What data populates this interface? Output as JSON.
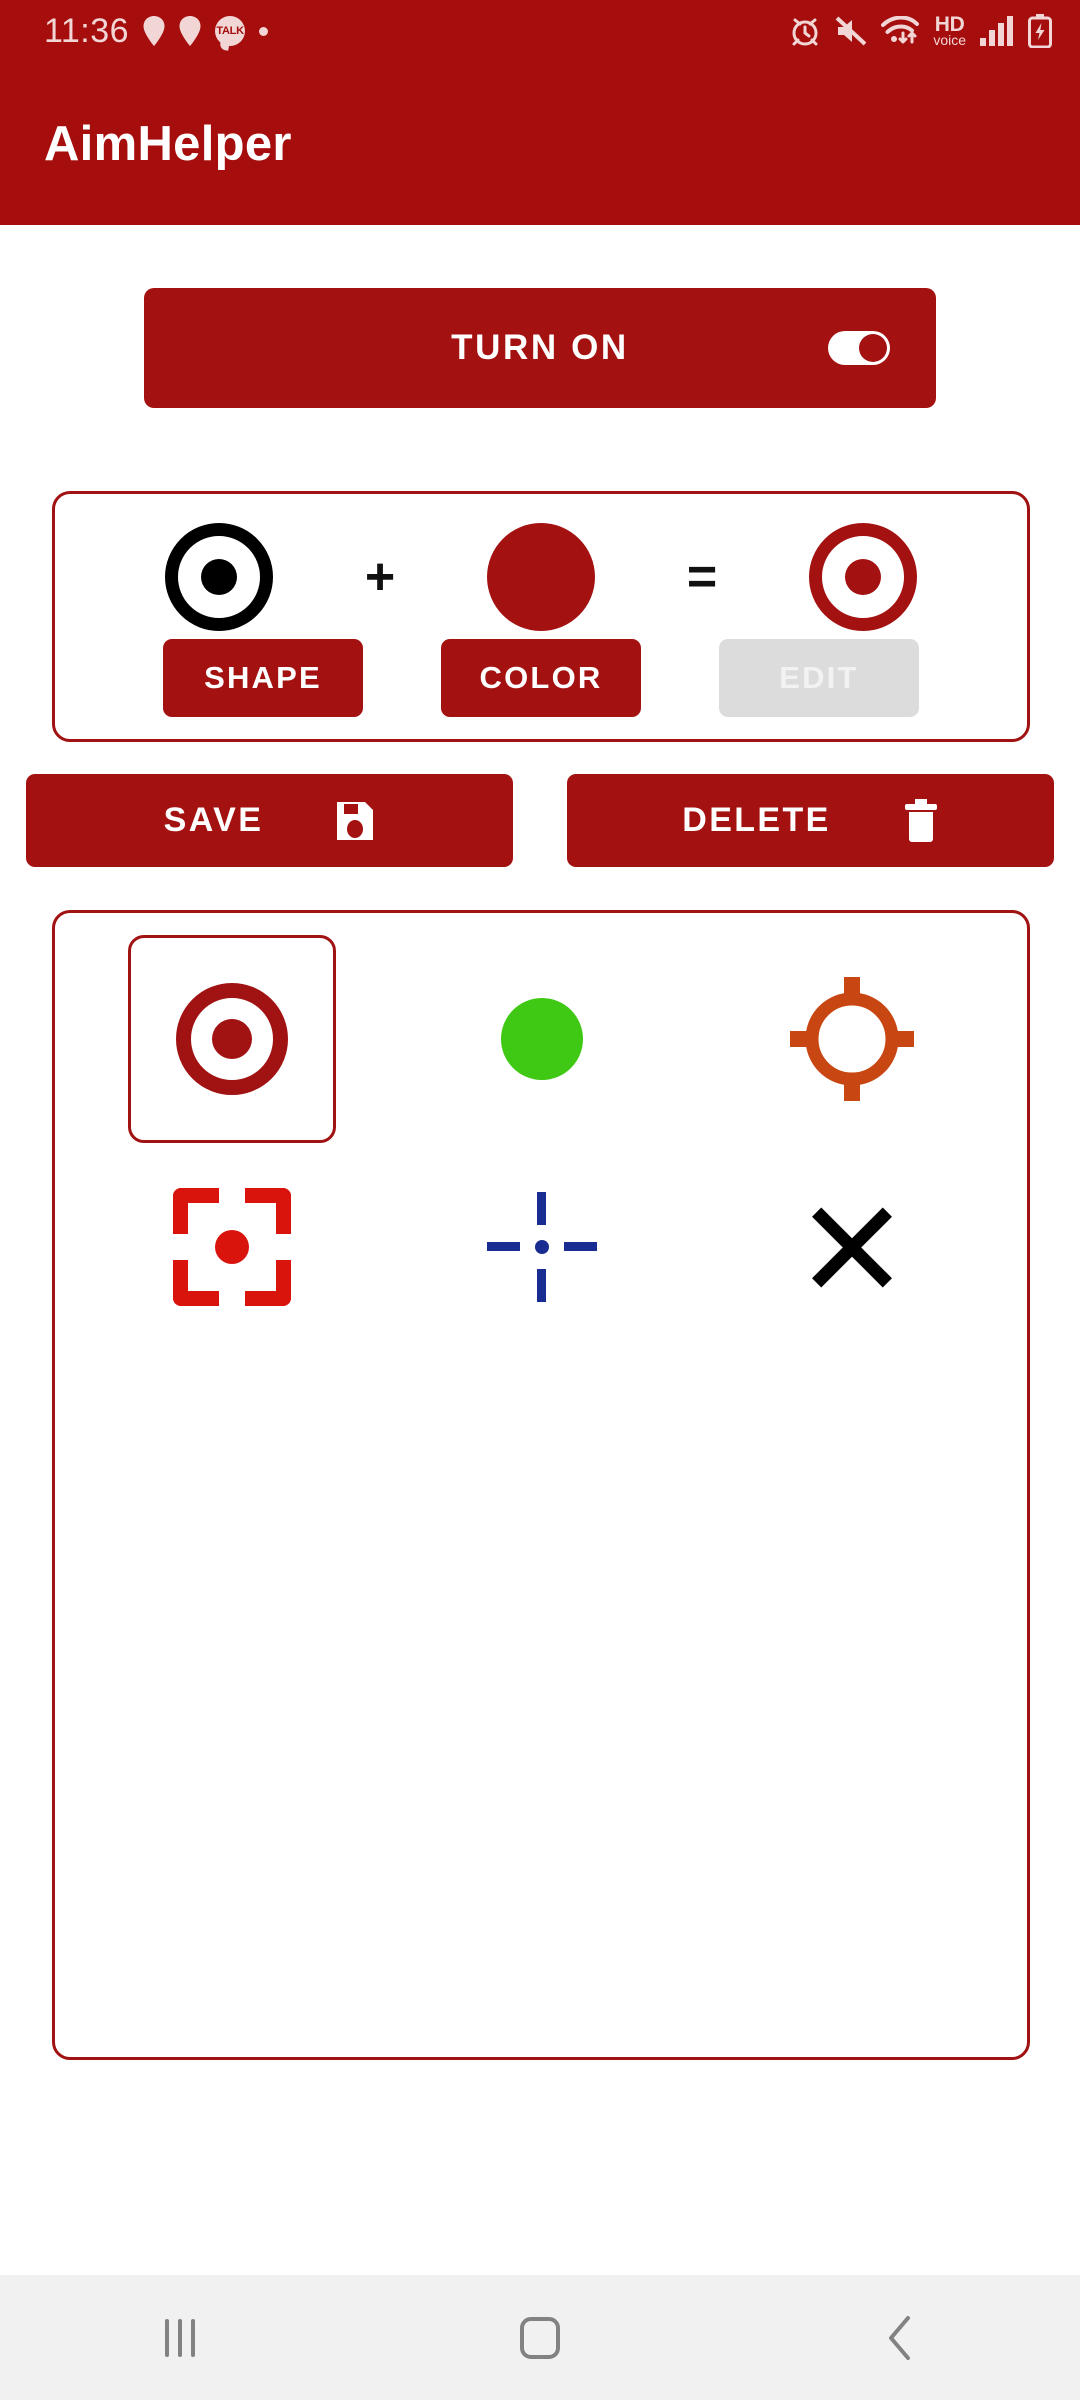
{
  "status_bar": {
    "clock": "11:36",
    "left_icons": [
      "location-pin-icon",
      "location-pin-icon",
      "kakao-talk-icon",
      "dot-indicator-icon"
    ],
    "talk_label": "TALK",
    "right_icons": [
      "alarm-clock-icon",
      "mute-speaker-icon",
      "wifi-data-icon",
      "hd-voice-icon",
      "signal-bars-icon",
      "battery-charging-icon"
    ],
    "hd_voice_line1": "HD",
    "hd_voice_line2": "voice",
    "background_color": "#A60E0E",
    "foreground_color": "#F2D6D6"
  },
  "app_bar": {
    "title": "AimHelper",
    "background_color": "#A60E0E",
    "title_color": "#FFFFFF"
  },
  "main": {
    "power_button": {
      "label": "TURN ON",
      "toggle_state": "on",
      "toggle_icon": "toggle-switch-on-icon",
      "background_color": "#A41111"
    },
    "editor_card": {
      "equation": {
        "shape_preview": {
          "icon": "ring-with-dot-icon",
          "color": "#000000"
        },
        "operator_plus": "+",
        "color_preview": {
          "icon": "filled-circle-icon",
          "color": "#A41111"
        },
        "operator_equals": "=",
        "result_preview": {
          "icon": "ring-with-dot-icon",
          "color": "#A41111"
        }
      },
      "buttons": [
        {
          "label": "SHAPE",
          "name": "shape-button",
          "enabled": true
        },
        {
          "label": "COLOR",
          "name": "color-button",
          "enabled": true
        },
        {
          "label": "EDIT",
          "name": "edit-button",
          "enabled": false
        }
      ],
      "border_color": "#A11212"
    },
    "actions": [
      {
        "label": "SAVE",
        "icon": "floppy-disk-save-icon"
      },
      {
        "label": "DELETE",
        "icon": "trash-can-icon"
      }
    ],
    "crosshair_gallery": {
      "border_color": "#A11212",
      "selected_index": 0,
      "items": [
        {
          "name": "crosshair-ring-dot-red",
          "glyph": "ring-with-dot-icon",
          "color": "#A11212",
          "selected": true
        },
        {
          "name": "crosshair-green-circle",
          "glyph": "filled-circle-icon",
          "color": "#3FC814",
          "selected": false
        },
        {
          "name": "crosshair-target-ticks-orange",
          "glyph": "target-with-ticks-icon",
          "color": "#C84612",
          "selected": false
        },
        {
          "name": "crosshair-corner-brackets-red",
          "glyph": "corner-brackets-dot-icon",
          "color": "#D8140C",
          "selected": false
        },
        {
          "name": "crosshair-blue-cross",
          "glyph": "segmented-cross-dot-icon",
          "color": "#182C91",
          "selected": false
        },
        {
          "name": "crosshair-black-x",
          "glyph": "x-mark-icon",
          "color": "#000000",
          "selected": false
        }
      ]
    }
  },
  "nav_bar": {
    "background_color": "#F1F1F1",
    "buttons": [
      {
        "name": "nav-recents-button",
        "icon": "recents-bars-icon"
      },
      {
        "name": "nav-home-button",
        "icon": "home-square-icon"
      },
      {
        "name": "nav-back-button",
        "icon": "chevron-left-icon"
      }
    ]
  }
}
